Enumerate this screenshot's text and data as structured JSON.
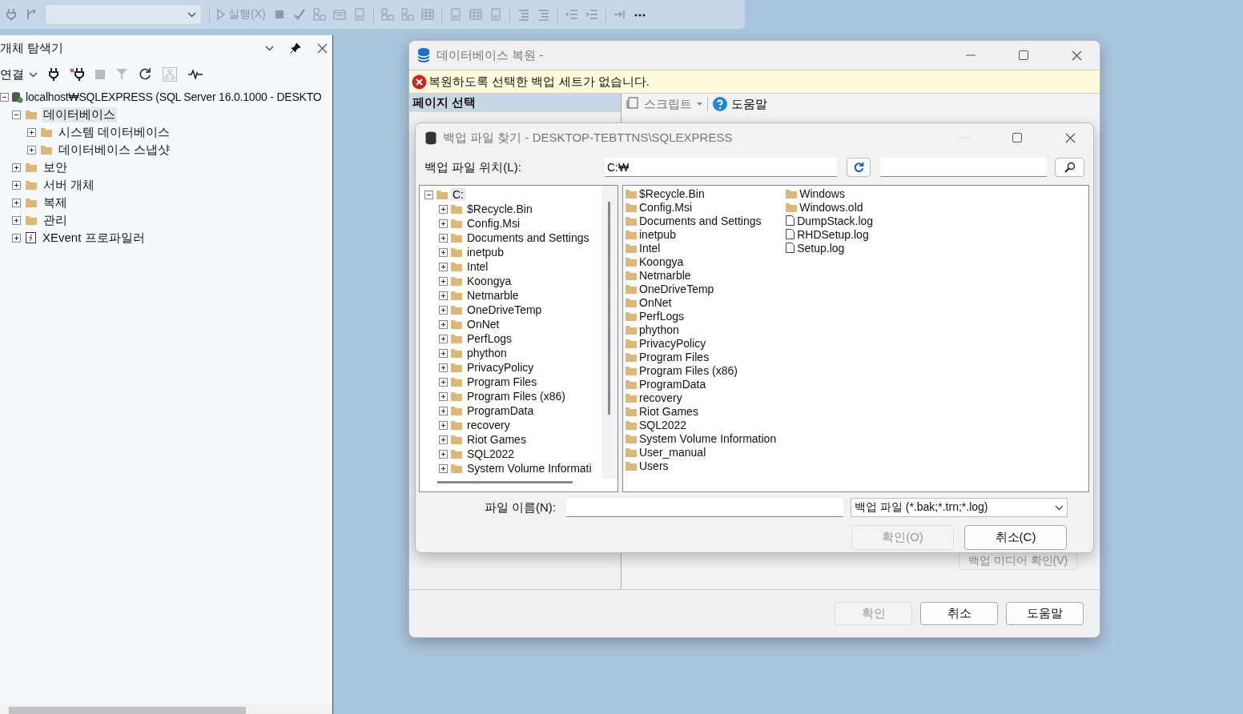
{
  "toolbar": {
    "execute_label": "실행(X)"
  },
  "object_explorer": {
    "title": "개체 탐색기",
    "connect_label": "연결",
    "tree": [
      {
        "label": "localhost₩SQLEXPRESS (SQL Server 16.0.1000 - DESKTO",
        "kind": "server",
        "expanded": true,
        "selected": false,
        "children": [
          {
            "label": "데이터베이스",
            "kind": "folder",
            "expanded": true,
            "selected": true,
            "children": [
              {
                "label": "시스템 데이터베이스",
                "kind": "folder",
                "expanded": false,
                "selected": false
              },
              {
                "label": "데이터베이스 스냅샷",
                "kind": "folder",
                "expanded": false,
                "selected": false
              }
            ]
          },
          {
            "label": "보안",
            "kind": "folder",
            "expanded": false,
            "selected": false
          },
          {
            "label": "서버 개체",
            "kind": "folder",
            "expanded": false,
            "selected": false
          },
          {
            "label": "복제",
            "kind": "folder",
            "expanded": false,
            "selected": false
          },
          {
            "label": "관리",
            "kind": "folder",
            "expanded": false,
            "selected": false
          },
          {
            "label": "XEvent 프로파일러",
            "kind": "xevent",
            "expanded": false,
            "selected": false
          }
        ]
      }
    ]
  },
  "restore_dialog": {
    "title": "데이터베이스 복원 -",
    "error": "복원하도록 선택한 백업 세트가 없습니다.",
    "page_select": "페이지 선택",
    "script_label": "스크립트",
    "help_label": "도움말",
    "verify_button": {
      "label": "백업 미디어 확인(V)",
      "disabled": true
    },
    "buttons": [
      {
        "label": "확인",
        "disabled": true
      },
      {
        "label": "취소",
        "disabled": false
      },
      {
        "label": "도움말",
        "disabled": false
      }
    ]
  },
  "find_backup_dialog": {
    "title": "백업 파일 찾기 - DESKTOP-TEBTTNS\\SQLEXPRESS",
    "location_label": "백업 파일 위치(L):",
    "location_value": "C:₩",
    "tree": {
      "label": "C:",
      "expanded": true,
      "selected": true,
      "children": [
        {
          "label": "$Recycle.Bin",
          "expanded": false,
          "selected": false
        },
        {
          "label": "Config.Msi",
          "expanded": false,
          "selected": false
        },
        {
          "label": "Documents and Settings",
          "expanded": false,
          "selected": false
        },
        {
          "label": "inetpub",
          "expanded": false,
          "selected": false
        },
        {
          "label": "Intel",
          "expanded": false,
          "selected": false
        },
        {
          "label": "Koongya",
          "expanded": false,
          "selected": false
        },
        {
          "label": "Netmarble",
          "expanded": false,
          "selected": false
        },
        {
          "label": "OneDriveTemp",
          "expanded": false,
          "selected": false
        },
        {
          "label": "OnNet",
          "expanded": false,
          "selected": false
        },
        {
          "label": "PerfLogs",
          "expanded": false,
          "selected": false
        },
        {
          "label": "phython",
          "expanded": false,
          "selected": false
        },
        {
          "label": "PrivacyPolicy",
          "expanded": false,
          "selected": false
        },
        {
          "label": "Program Files",
          "expanded": false,
          "selected": false
        },
        {
          "label": "Program Files (x86)",
          "expanded": false,
          "selected": false
        },
        {
          "label": "ProgramData",
          "expanded": false,
          "selected": false
        },
        {
          "label": "recovery",
          "expanded": false,
          "selected": false
        },
        {
          "label": "Riot Games",
          "expanded": false,
          "selected": false
        },
        {
          "label": "SQL2022",
          "expanded": false,
          "selected": false
        },
        {
          "label": "System Volume Informati",
          "expanded": false,
          "selected": false
        }
      ]
    },
    "files": [
      {
        "name": "$Recycle.Bin",
        "kind": "folder"
      },
      {
        "name": "Config.Msi",
        "kind": "folder"
      },
      {
        "name": "Documents and Settings",
        "kind": "folder"
      },
      {
        "name": "inetpub",
        "kind": "folder"
      },
      {
        "name": "Intel",
        "kind": "folder"
      },
      {
        "name": "Koongya",
        "kind": "folder"
      },
      {
        "name": "Netmarble",
        "kind": "folder"
      },
      {
        "name": "OneDriveTemp",
        "kind": "folder"
      },
      {
        "name": "OnNet",
        "kind": "folder"
      },
      {
        "name": "PerfLogs",
        "kind": "folder"
      },
      {
        "name": "phython",
        "kind": "folder"
      },
      {
        "name": "PrivacyPolicy",
        "kind": "folder"
      },
      {
        "name": "Program Files",
        "kind": "folder"
      },
      {
        "name": "Program Files (x86)",
        "kind": "folder"
      },
      {
        "name": "ProgramData",
        "kind": "folder"
      },
      {
        "name": "recovery",
        "kind": "folder"
      },
      {
        "name": "Riot Games",
        "kind": "folder"
      },
      {
        "name": "SQL2022",
        "kind": "folder"
      },
      {
        "name": "System Volume Information",
        "kind": "folder"
      },
      {
        "name": "User_manual",
        "kind": "folder"
      },
      {
        "name": "Users",
        "kind": "folder"
      },
      {
        "name": "Windows",
        "kind": "folder"
      },
      {
        "name": "Windows.old",
        "kind": "folder"
      },
      {
        "name": "DumpStack.log",
        "kind": "file"
      },
      {
        "name": "RHDSetup.log",
        "kind": "file"
      },
      {
        "name": "Setup.log",
        "kind": "file"
      }
    ],
    "filename_label": "파일 이름(N):",
    "filter": "백업 파일 (*.bak;*.trn;*.log)",
    "buttons": [
      {
        "label": "확인(O)",
        "disabled": true
      },
      {
        "label": "취소(C)",
        "disabled": false
      }
    ]
  }
}
